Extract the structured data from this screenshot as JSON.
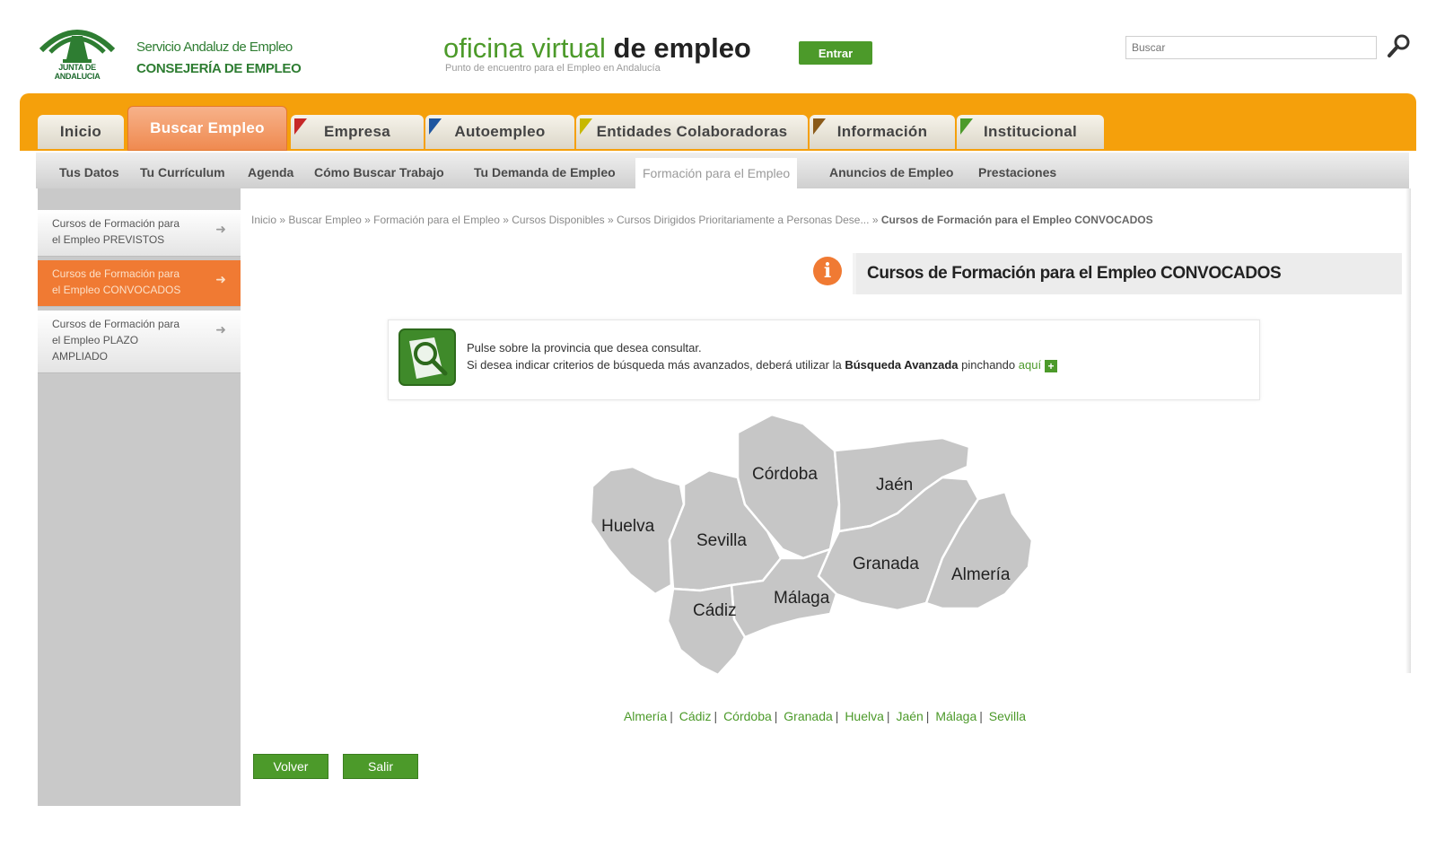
{
  "header": {
    "junta_text": "JUNTA DE ANDALUCIA",
    "brand_line1": "Servicio Andaluz de Empleo",
    "brand_line2": "CONSEJERÍA DE EMPLEO",
    "title_part1": "oficina virtual",
    "title_part2": "de empleo",
    "subtitle": "Punto de encuentro para el Empleo en Andalucía",
    "entrar_label": "Entrar",
    "search_placeholder": "Buscar"
  },
  "main_nav": {
    "tabs": [
      {
        "label": "Inicio",
        "active": false
      },
      {
        "label": "Buscar Empleo",
        "active": true
      },
      {
        "label": "Empresa",
        "active": false
      },
      {
        "label": "Autoempleo",
        "active": false
      },
      {
        "label": "Entidades Colaboradoras",
        "active": false
      },
      {
        "label": "Información",
        "active": false
      },
      {
        "label": "Institucional",
        "active": false
      }
    ]
  },
  "sub_nav": {
    "items": [
      "Tus Datos",
      "Tu Currículum",
      "Agenda",
      "Cómo Buscar Trabajo",
      "Tu Demanda de Empleo",
      "Formación para el Empleo",
      "Anuncios de Empleo",
      "Prestaciones"
    ],
    "active": "Formación para el Empleo"
  },
  "sidebar": {
    "items": [
      {
        "line1": "Cursos de Formación para",
        "line2": "el Empleo PREVISTOS",
        "line3": "",
        "active": false
      },
      {
        "line1": "Cursos de Formación para",
        "line2": "el Empleo CONVOCADOS",
        "line3": "",
        "active": true
      },
      {
        "line1": "Cursos de Formación para",
        "line2": "el Empleo PLAZO",
        "line3": "AMPLIADO",
        "active": false
      }
    ]
  },
  "breadcrumb": {
    "items": [
      "Inicio",
      "Buscar Empleo",
      "Formación para el Empleo",
      "Cursos Disponibles",
      "Cursos Dirigidos Prioritariamente a Personas Dese..."
    ],
    "current": "Cursos de Formación para el Empleo CONVOCADOS",
    "separator": "»"
  },
  "page": {
    "heading": "Cursos de Formación para el Empleo CONVOCADOS",
    "info_line1": "Pulse sobre la provincia que desea consultar.",
    "info_line2_pre": "Si desea indicar criterios de búsqueda más avanzados, deberá utilizar la",
    "info_line2_bold": "Búsqueda Avanzada",
    "info_line2_mid": "pinchando",
    "info_line2_link": "aquí"
  },
  "map": {
    "provinces": [
      "Huelva",
      "Sevilla",
      "Córdoba",
      "Jaén",
      "Granada",
      "Almería",
      "Málaga",
      "Cádiz"
    ]
  },
  "province_links": [
    "Almería",
    "Cádiz",
    "Córdoba",
    "Granada",
    "Huelva",
    "Jaén",
    "Málaga",
    "Sevilla"
  ],
  "buttons": {
    "volver": "Volver",
    "salir": "Salir"
  },
  "colors": {
    "brand_green": "#4c9a2a",
    "nav_orange": "#f5a00b",
    "active_orange": "#f07a33",
    "map_gray": "#c6c6c6"
  }
}
